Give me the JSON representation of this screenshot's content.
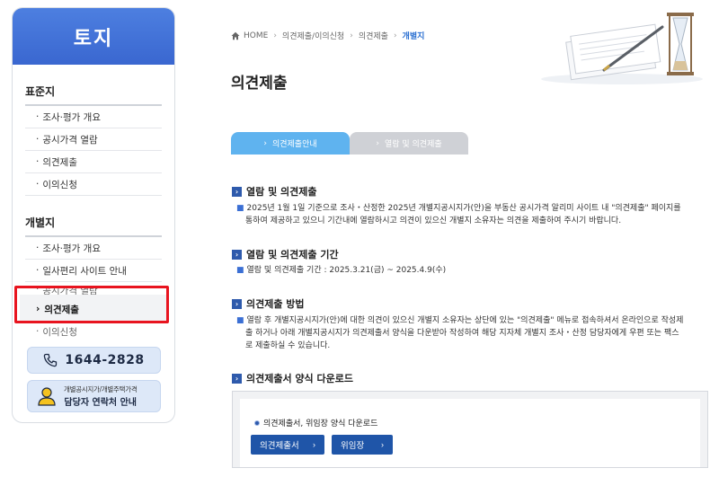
{
  "sidebar": {
    "title": "토지",
    "section1": {
      "title": "표준지",
      "items": [
        "조사·평가 개요",
        "공시가격 열람",
        "의견제출",
        "이의신청"
      ]
    },
    "section2": {
      "title": "개별지",
      "items": [
        "조사·평가 개요",
        "일사편리 사이트 안내"
      ],
      "clipped_item": "공시가격 열람",
      "active_item": "의견제출",
      "after_item": "이의신청"
    },
    "phone": "1644-2828",
    "contact_line1": "개별공시지가/개별주택가격",
    "contact_line2": "담당자 연락처 안내"
  },
  "breadcrumb": {
    "home": "HOME",
    "items": [
      "의견제출/이의신청",
      "의견제출"
    ],
    "current": "개별지"
  },
  "page_title": "의견제출",
  "tabs": [
    {
      "label": "의견제출안내",
      "active": true
    },
    {
      "label": "열람 및 의견제출",
      "active": false
    }
  ],
  "sections": [
    {
      "title": "열람 및 의견제출",
      "lines": [
        "2025년 1월 1일 기준으로 조사・산정한 2025년 개별지공시지가(안)을 부동산 공시가격 알리미 사이트 내 \"의견제출\" 페이지를",
        "통하여 제공하고 있으니 기간내에 열람하시고 의견이 있으신 개별지 소유자는 의견을 제출하여 주시기 바랍니다."
      ]
    },
    {
      "title": "열람 및 의견제출 기간",
      "lines": [
        "열람 및 의견제출 기간 : 2025.3.21(금) ~ 2025.4.9(수)"
      ]
    },
    {
      "title": "의견제출 방법",
      "lines": [
        "열람 후 개별지공시지가(안)에 대한 의견이 있으신 개별지 소유자는 상단에 있는 \"의견제출\" 메뉴로 접속하셔서 온라인으로 작성제",
        "출 하거나 아래 개별지공시지가 의견제출서 양식을 다운받아 작성하여 해당 지자체 개별지 조사・산정 담당자에게 우편 또는 팩스",
        "로 제출하실 수 있습니다."
      ]
    },
    {
      "title": "의견제출서 양식 다운로드",
      "lines": []
    }
  ],
  "download": {
    "note": "의견제출서, 위임장 양식 다운로드",
    "btn1": "의견제출서",
    "btn2": "위임장"
  },
  "colors": {
    "sidebar_header": "#4175d8",
    "tab_active": "#5fb3ef",
    "tab_inactive": "#cfd1d6",
    "button": "#1f55a8",
    "highlight": "#e8141f"
  }
}
